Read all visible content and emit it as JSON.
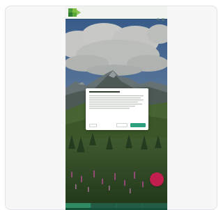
{
  "colors": {
    "accent": "#2ea27d",
    "fab": "#c21f4e",
    "bottom_nav": "#1f6b4d",
    "topbar": "#f1f3ee"
  },
  "icons": {
    "logo": "clover-logo",
    "search": "search-icon",
    "menu": "menu-icon"
  }
}
